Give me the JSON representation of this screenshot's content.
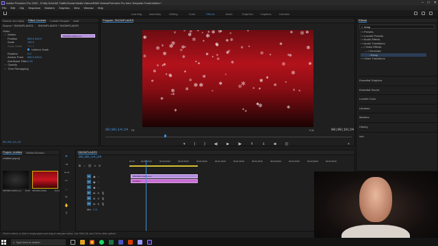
{
  "window": {
    "title": "Adobe Premiere Pro 2022 - D:\\My Drive\\02 Traffic\\Social Media Videos\\RAW Videos\\Premiere Pro Intro Template Final\\Untitled *"
  },
  "menu": [
    "File",
    "Edit",
    "Clip",
    "Sequence",
    "Markers",
    "Graphics",
    "View",
    "Window",
    "Help"
  ],
  "workspaces": {
    "tabs": [
      "Learning",
      "Assembly",
      "Editing",
      "Color",
      "Effects",
      "Audio",
      "Graphics",
      "Captions",
      "Libraries"
    ],
    "active": "Effects"
  },
  "effect_controls": {
    "tabs": [
      "Source: (no clips)",
      "Effect Controls",
      "Lumetri Scopes",
      "Audi"
    ],
    "source_line": "Source * SNOWFLAKES...",
    "sequence_line": "SNOWFLAKES * SNOWFLAKES",
    "clip_label": "SNOWFLAKES.mov",
    "section_video": "Video",
    "rows": [
      {
        "name": "Motion",
        "value": ""
      },
      {
        "name": "Position",
        "value": "960.0   540.0"
      },
      {
        "name": "Scale",
        "value": "100.0"
      },
      {
        "name": "Scale Width",
        "value": "100.0"
      },
      {
        "name": "Uniform Scale",
        "value": ""
      },
      {
        "name": "Rotation",
        "value": "0.0"
      },
      {
        "name": "Anchor Point",
        "value": "960.0   540.0"
      },
      {
        "name": "Anti-flicker Filter",
        "value": "0.00"
      },
      {
        "name": "Opacity",
        "value": ""
      },
      {
        "name": "Time Remapping",
        "value": ""
      }
    ],
    "timecode": "00;00;14;24"
  },
  "program": {
    "tab": "Program: SNOWFLAKES",
    "timecode": "00;00;14;24",
    "fit": "Fit",
    "quality": "Full",
    "duration": "00;00;19;24"
  },
  "effects_panel": {
    "title": "Effects",
    "search": "temp",
    "tree": [
      "Presets",
      "Lumetri Presets",
      "Audio Effects",
      "Audio Transitions",
      "Video Effects",
      "Generate",
      "Ramp",
      "Video Transitions"
    ],
    "sections": [
      "Essential Graphics",
      "Essential Sound",
      "Lumetri Color",
      "Libraries",
      "Markers",
      "History",
      "Info"
    ]
  },
  "project": {
    "tabs": [
      "Project: Untitled",
      "Media Browser"
    ],
    "file": "Untitled.prproj",
    "items": [
      {
        "name": "SNOWFLAKES.mov",
        "dur": "19;24"
      },
      {
        "name": "SNOWFLAKES",
        "dur": "19;24"
      }
    ]
  },
  "timeline": {
    "tab": "SNOWFLAKES",
    "timecode": "00;00;14;24",
    "ruler": [
      "00;00",
      "00;00;15;00",
      "00;00;30;00",
      "00;00;45;00",
      "00;01;00;00",
      "00;01;15;00",
      "00;01;30;00",
      "00;01;45;00",
      "00;02;00;00",
      "00;02;15;00",
      "00;02;30;00",
      "00;02;45;00"
    ],
    "tracks": [
      "V3",
      "V2",
      "V1",
      "A1",
      "A2",
      "A3",
      "Mix"
    ],
    "mix_value": "0.0",
    "clip_video": "SNOWFLAKES.mov",
    "clip_audio": "Gradient"
  },
  "status": "Click to select, or click in empty space and drag to marquee select. Use Shift, Alt, and Ctrl for other options.",
  "taskbar": {
    "search": "Type here to search"
  }
}
